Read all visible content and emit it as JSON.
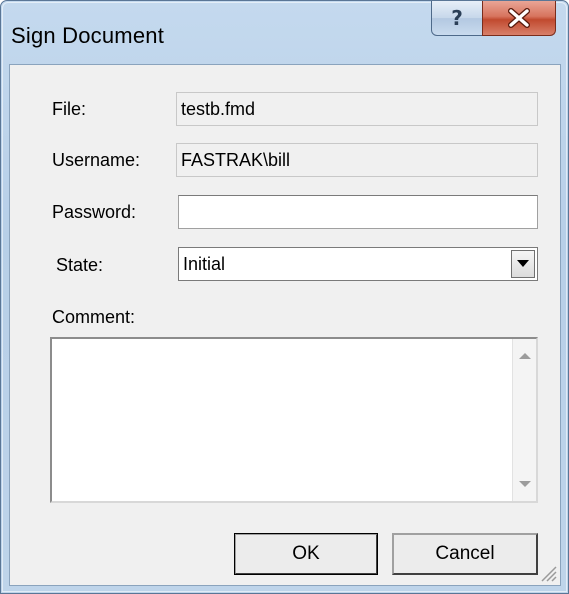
{
  "window": {
    "title": "Sign Document"
  },
  "caption_buttons": {
    "help_icon": "question-mark-icon",
    "close_icon": "close-x-icon"
  },
  "form": {
    "file": {
      "label": "File:",
      "value": "testb.fmd"
    },
    "username": {
      "label": "Username:",
      "value": "FASTRAK\\bill"
    },
    "password": {
      "label": "Password:",
      "value": ""
    },
    "state": {
      "label": "State:",
      "value": "Initial"
    },
    "comment": {
      "label": "Comment:",
      "value": ""
    }
  },
  "buttons": {
    "ok": "OK",
    "cancel": "Cancel"
  },
  "colors": {
    "frame": "#bcd3ea",
    "client": "#f0f0f0",
    "close_button": "#c8553b"
  }
}
